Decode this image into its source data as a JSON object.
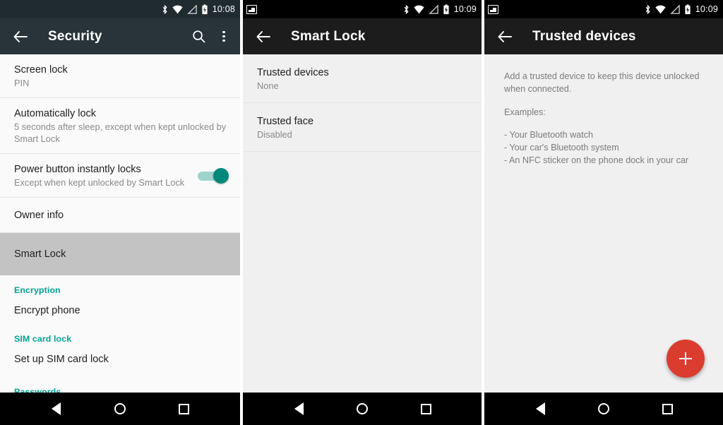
{
  "panels": [
    {
      "id": "security",
      "statusbar": {
        "time": "10:08",
        "icons": [
          "bluetooth-icon",
          "wifi-icon",
          "signal-icon",
          "battery-charging-icon"
        ]
      },
      "toolbar": {
        "back_icon": "arrow-back-icon",
        "title": "Security",
        "actions": [
          "search-icon",
          "overflow-menu-icon"
        ]
      },
      "rows": [
        {
          "title": "Screen lock",
          "sub": "PIN",
          "toggle": null
        },
        {
          "title": "Automatically lock",
          "sub": "5 seconds after sleep, except when kept unlocked by Smart Lock",
          "toggle": null
        },
        {
          "title": "Power button instantly locks",
          "sub": "Except when kept unlocked by Smart Lock",
          "toggle": "on"
        },
        {
          "title": "Owner info",
          "sub": "",
          "toggle": null
        },
        {
          "title": "Smart Lock",
          "sub": "",
          "toggle": null,
          "selected": true
        }
      ],
      "sections": [
        {
          "header": "Encryption",
          "items": [
            "Encrypt phone"
          ]
        },
        {
          "header": "SIM card lock",
          "items": [
            "Set up SIM card lock"
          ]
        },
        {
          "header": "Passwords",
          "items": []
        }
      ]
    },
    {
      "id": "smart-lock",
      "statusbar": {
        "time": "10:09",
        "notification_icon": "screenshot-image-icon",
        "icons": [
          "bluetooth-icon",
          "wifi-icon",
          "signal-icon",
          "battery-charging-icon"
        ]
      },
      "toolbar": {
        "back_icon": "arrow-back-icon",
        "title": "Smart Lock",
        "actions": []
      },
      "rows": [
        {
          "title": "Trusted devices",
          "sub": "None"
        },
        {
          "title": "Trusted face",
          "sub": "Disabled"
        }
      ]
    },
    {
      "id": "trusted-devices",
      "statusbar": {
        "time": "10:09",
        "notification_icon": "screenshot-image-icon",
        "icons": [
          "bluetooth-icon",
          "wifi-icon",
          "signal-icon",
          "battery-charging-icon"
        ]
      },
      "toolbar": {
        "back_icon": "arrow-back-icon",
        "title": "Trusted devices",
        "actions": []
      },
      "body": {
        "intro": "Add a trusted device to keep this device unlocked when connected.",
        "examples_label": "Examples:",
        "examples": [
          "- Your Bluetooth watch",
          "- Your car's Bluetooth system",
          "- An NFC sticker on the phone dock in your car"
        ]
      },
      "fab": {
        "icon": "plus-icon",
        "color": "#db3c30"
      }
    }
  ],
  "navbar": {
    "back": "nav-back-icon",
    "home": "nav-home-icon",
    "recents": "nav-recents-icon"
  },
  "colors": {
    "toolbar_security": "#28343a",
    "toolbar_dark": "#1c1c1c",
    "accent_teal": "#00a392",
    "toggle_on": "#00897b",
    "fab_red": "#db3c30",
    "selected_row": "#c3c3c3"
  }
}
